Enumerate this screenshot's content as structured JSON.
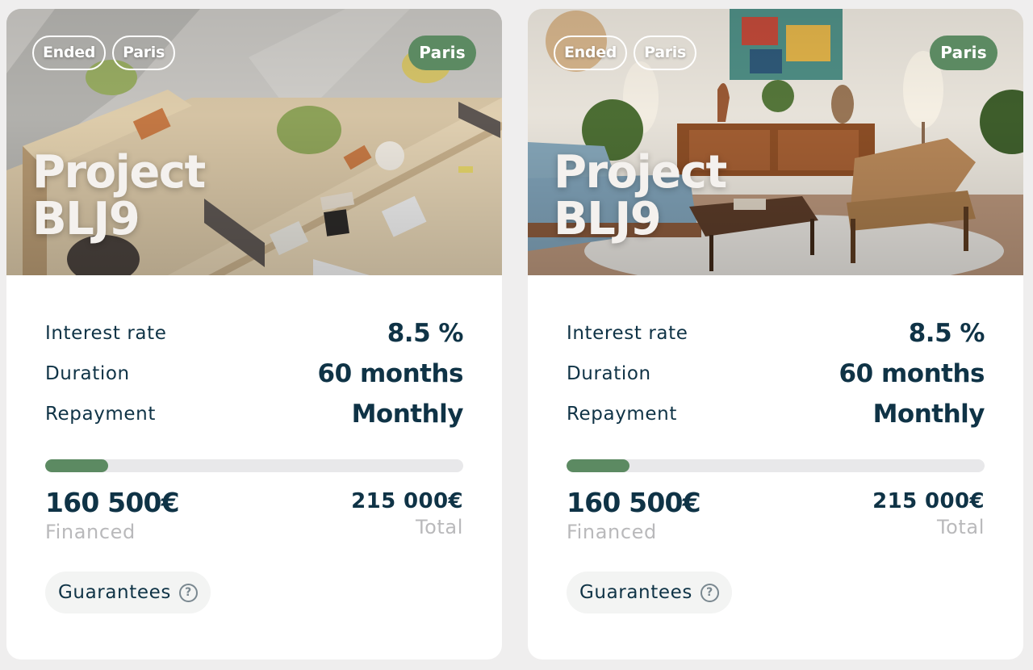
{
  "projects": [
    {
      "tags": [
        "Ended",
        "Paris"
      ],
      "city_badge": "Paris",
      "title": "Project BLJ9",
      "image": "open-plan office with wooden desks and green chairs",
      "stats": [
        {
          "label": "Interest rate",
          "value": "8.5 %"
        },
        {
          "label": "Duration",
          "value": "60 months"
        },
        {
          "label": "Repayment",
          "value": "Monthly"
        }
      ],
      "progress_percent": 15,
      "financed_amount": "160 500€",
      "financed_label": "Financed",
      "total_amount": "215 000€",
      "total_label": "Total",
      "guarantees_label": "Guarantees"
    },
    {
      "tags": [
        "Ended",
        "Paris"
      ],
      "city_badge": "Paris",
      "title": "Project BLJ9",
      "image": "living room with blue sofa, wooden sideboard and armchair",
      "stats": [
        {
          "label": "Interest rate",
          "value": "8.5 %"
        },
        {
          "label": "Duration",
          "value": "60 months"
        },
        {
          "label": "Repayment",
          "value": "Monthly"
        }
      ],
      "progress_percent": 15,
      "financed_amount": "160 500€",
      "financed_label": "Financed",
      "total_amount": "215 000€",
      "total_label": "Total",
      "guarantees_label": "Guarantees"
    }
  ],
  "colors": {
    "accent": "#5c8a62",
    "text": "#0f3346",
    "muted": "#b9b9bb",
    "track": "#e8e8ea",
    "background": "#efeeee"
  }
}
